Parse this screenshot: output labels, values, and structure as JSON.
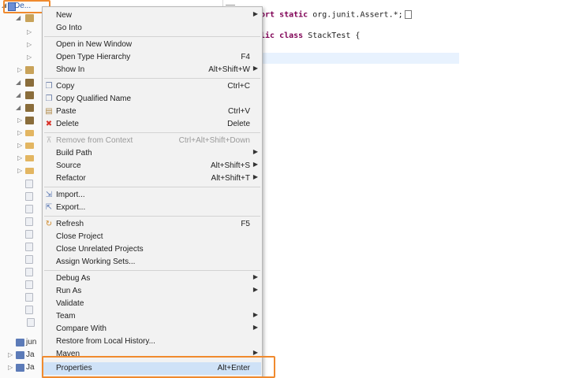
{
  "tree": {
    "root_label": "De...",
    "bottom_items": [
      "jun",
      "Ja",
      "Ja"
    ]
  },
  "editor": {
    "line1_kw": "ort static",
    "line1_rest": " org.junit.Assert.*;",
    "line2_kw": "lic class",
    "line2_rest": " StackTest {"
  },
  "menu": {
    "new": {
      "label": "New"
    },
    "go_into": {
      "label": "Go Into"
    },
    "open_new_window": {
      "label": "Open in New Window"
    },
    "open_type_hierarchy": {
      "label": "Open Type Hierarchy",
      "shortcut": "F4"
    },
    "show_in": {
      "label": "Show In",
      "shortcut": "Alt+Shift+W"
    },
    "copy": {
      "label": "Copy",
      "shortcut": "Ctrl+C"
    },
    "copy_qualified": {
      "label": "Copy Qualified Name"
    },
    "paste": {
      "label": "Paste",
      "shortcut": "Ctrl+V"
    },
    "delete": {
      "label": "Delete",
      "shortcut": "Delete"
    },
    "remove_from_context": {
      "label": "Remove from Context",
      "shortcut": "Ctrl+Alt+Shift+Down"
    },
    "build_path": {
      "label": "Build Path"
    },
    "source": {
      "label": "Source",
      "shortcut": "Alt+Shift+S"
    },
    "refactor": {
      "label": "Refactor",
      "shortcut": "Alt+Shift+T"
    },
    "import": {
      "label": "Import..."
    },
    "export": {
      "label": "Export..."
    },
    "refresh": {
      "label": "Refresh",
      "shortcut": "F5"
    },
    "close_project": {
      "label": "Close Project"
    },
    "close_unrelated": {
      "label": "Close Unrelated Projects"
    },
    "assign_working_sets": {
      "label": "Assign Working Sets..."
    },
    "debug_as": {
      "label": "Debug As"
    },
    "run_as": {
      "label": "Run As"
    },
    "validate": {
      "label": "Validate"
    },
    "team": {
      "label": "Team"
    },
    "compare_with": {
      "label": "Compare With"
    },
    "restore_local_history": {
      "label": "Restore from Local History..."
    },
    "maven": {
      "label": "Maven"
    },
    "properties": {
      "label": "Properties",
      "shortcut": "Alt+Enter"
    }
  },
  "icons": {
    "copy": "copy-icon",
    "paste": "paste-icon",
    "delete": "delete-icon",
    "import": "import-icon",
    "export": "export-icon",
    "refresh": "refresh-icon"
  },
  "colors": {
    "highlight": "#f08a2e",
    "hover": "#cfe2f7",
    "delete_red": "#d9342b"
  }
}
